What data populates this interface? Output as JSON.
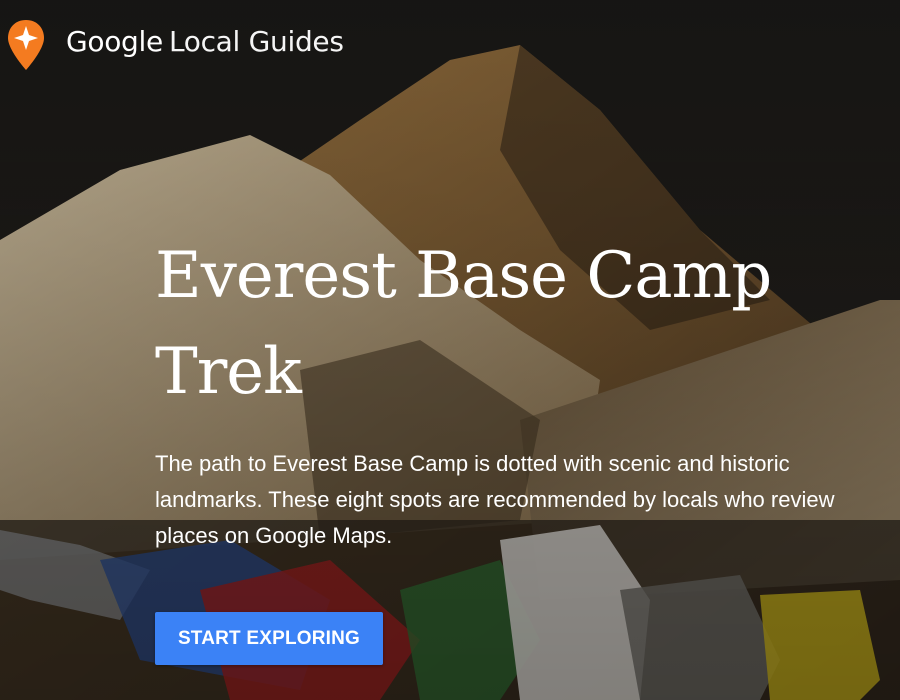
{
  "header": {
    "logo_icon": "local-guides-star-pin-icon",
    "brand_primary": "Google",
    "brand_secondary": "Local Guides"
  },
  "hero": {
    "title": "Everest Base Camp Trek",
    "description": "The path to Everest Base Camp is dotted with scenic and historic landmarks. These eight spots are recommended by locals who review places on Google Maps.",
    "cta_label": "START EXPLORING",
    "background": "mountain-peak-with-prayer-flags-photo"
  },
  "colors": {
    "accent": "#3b82f6",
    "logo_orange": "#f47b20",
    "text": "#ffffff"
  }
}
